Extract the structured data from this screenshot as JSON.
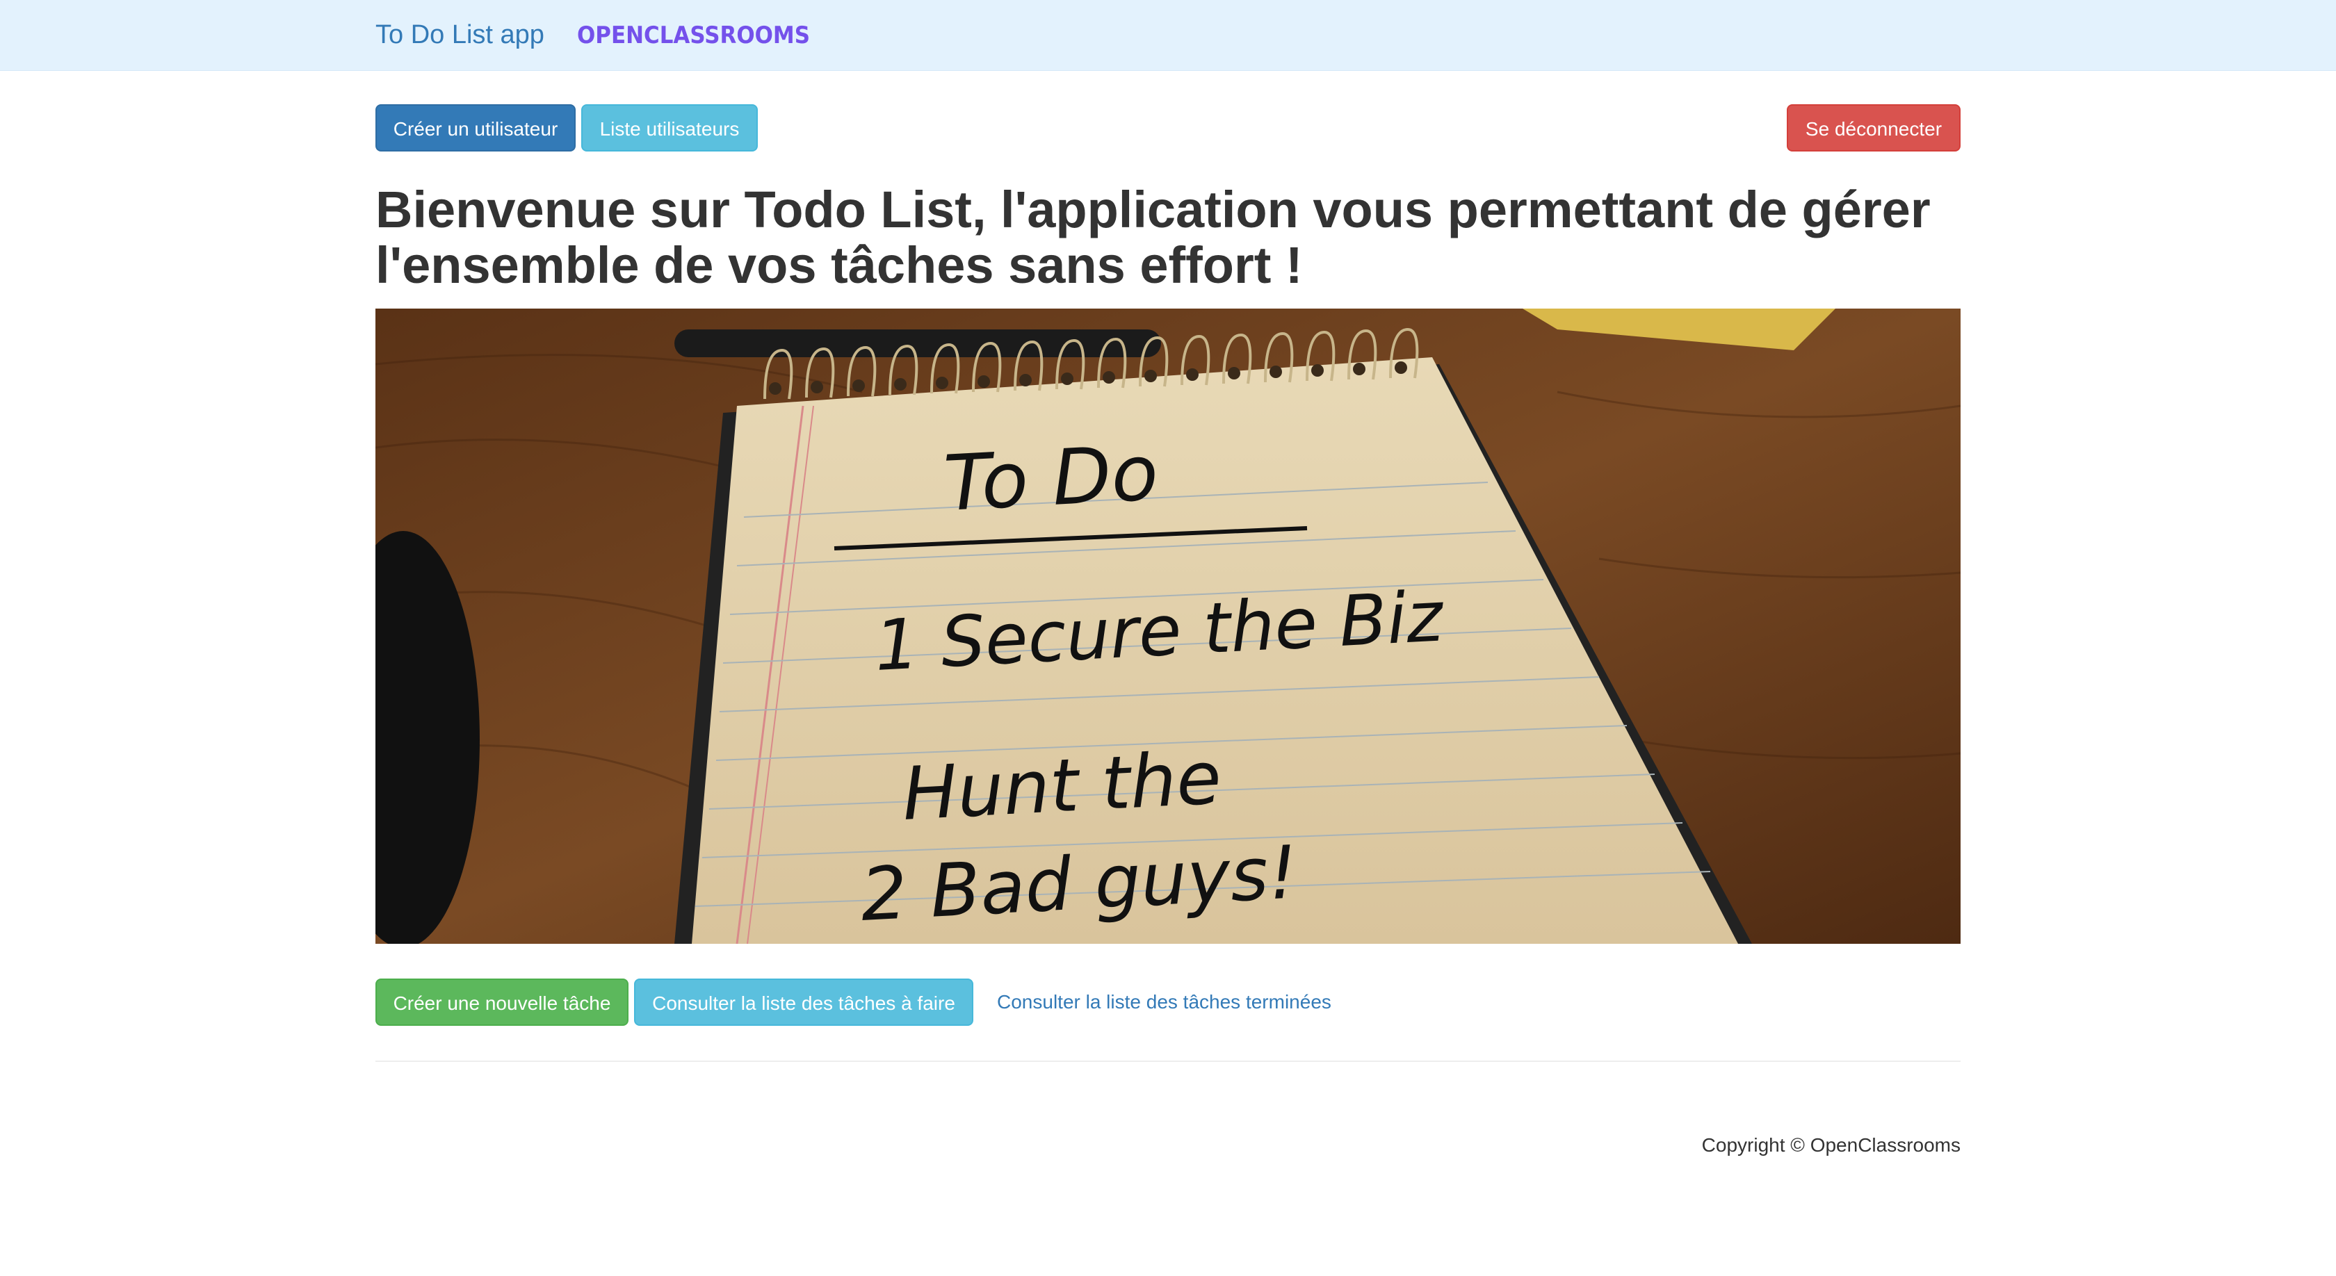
{
  "navbar": {
    "brand": "To Do List app",
    "logo_text": "OPENCLASSROOMS",
    "logo_color": "#7451eb",
    "background": "#e3f2fd"
  },
  "user_actions": {
    "create_user": "Créer un utilisateur",
    "list_users": "Liste utilisateurs",
    "logout": "Se déconnecter"
  },
  "main": {
    "headline_line1": "Bienvenue sur Todo List, l'application vous permettant de gérer",
    "headline_line2": "l'ensemble de vos tâches sans effort !",
    "hero_image_alt": "todo list",
    "note_lines": [
      "To Do",
      "1 Secure the Biz",
      "Hunt the",
      "2 Bad guys!"
    ]
  },
  "task_actions": {
    "create_task": "Créer une nouvelle tâche",
    "todo_list": "Consulter la liste des tâches à faire",
    "done_list": "Consulter la liste des tâches terminées"
  },
  "footer": {
    "copyright": "Copyright © OpenClassrooms"
  },
  "colors": {
    "primary": "#337ab7",
    "info": "#5bc0de",
    "danger": "#d9534f",
    "success": "#5cb85c"
  }
}
